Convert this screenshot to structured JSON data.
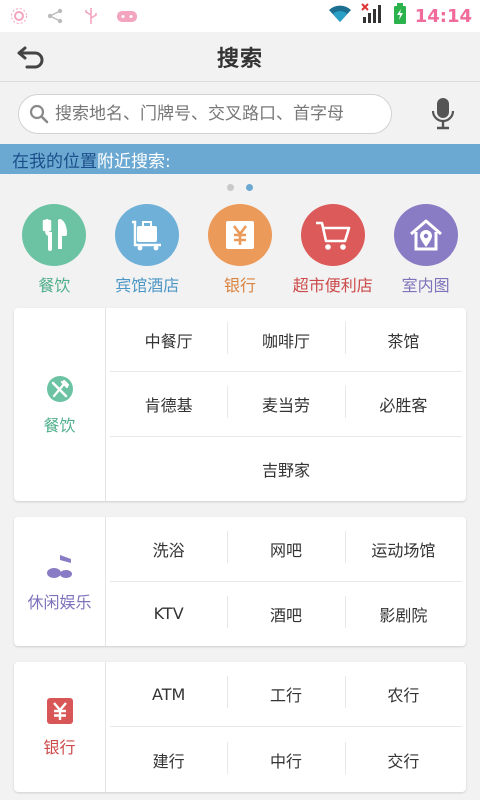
{
  "status_bar": {
    "time": "14:14",
    "time_color": "#f06a9a",
    "icons": [
      "sun-icon",
      "share-icon",
      "usb-icon",
      "game-icon",
      "wifi-icon",
      "signal-icon",
      "battery-icon"
    ]
  },
  "header": {
    "title": "搜索",
    "back_icon": "back-arrow-icon"
  },
  "search": {
    "placeholder": "搜索地名、门牌号、交叉路口、首字母",
    "value": ""
  },
  "nearby": {
    "link": "在我的位置",
    "text": "附近搜索:"
  },
  "pager": {
    "count": 2,
    "active": 1
  },
  "categories": [
    {
      "label": "餐饮",
      "icon": "fork-knife-icon",
      "color": "#6cc3a3",
      "text_color": "#4fae8b"
    },
    {
      "label": "宾馆酒店",
      "icon": "luggage-cart-icon",
      "color": "#6fb0d8",
      "text_color": "#4d97c6"
    },
    {
      "label": "银行",
      "icon": "yen-icon",
      "color": "#ec9a5a",
      "text_color": "#d98340"
    },
    {
      "label": "超市便利店",
      "icon": "shopping-cart-icon",
      "color": "#dc5a5a",
      "text_color": "#cc4a4a"
    },
    {
      "label": "室内图",
      "icon": "indoor-map-icon",
      "color": "#8a7cc4",
      "text_color": "#7f72bb"
    }
  ],
  "sections": [
    {
      "label": "餐饮",
      "icon": "fork-knife-icon",
      "color": "#6cc3a3",
      "rows": [
        [
          "中餐厅",
          "咖啡厅",
          "茶馆"
        ],
        [
          "肯德基",
          "麦当劳",
          "必胜客"
        ],
        [
          "吉野家"
        ]
      ]
    },
    {
      "label": "休闲娱乐",
      "icon": "music-note-icon",
      "color": "#8a7cc4",
      "rows": [
        [
          "洗浴",
          "网吧",
          "运动场馆"
        ],
        [
          "KTV",
          "酒吧",
          "影剧院"
        ]
      ]
    },
    {
      "label": "银行",
      "icon": "yen-icon",
      "color": "#d95656",
      "rows": [
        [
          "ATM",
          "工行",
          "农行"
        ],
        [
          "建行",
          "中行",
          "交行"
        ]
      ]
    }
  ]
}
